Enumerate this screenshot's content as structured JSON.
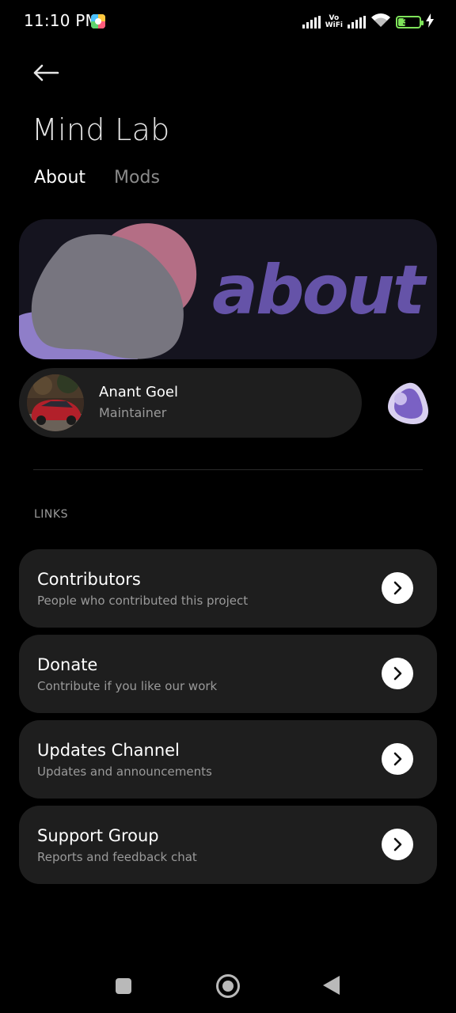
{
  "status_bar": {
    "time": "11:10 PM",
    "network_label_top": "Vo",
    "network_label_bottom": "WiFi",
    "battery_level": "33",
    "battery_color": "#7ee35a"
  },
  "header": {
    "back_icon": "arrow-left-icon",
    "title": "Mind Lab"
  },
  "tabs": [
    {
      "label": "About",
      "active": true
    },
    {
      "label": "Mods",
      "active": false
    }
  ],
  "banner": {
    "text": "about",
    "background": "#15141f",
    "accent": "#6553a8"
  },
  "maintainer": {
    "name": "Anant Goel",
    "role": "Maintainer"
  },
  "links_section": {
    "label": "LINKS",
    "items": [
      {
        "title": "Contributors",
        "subtitle": "People who contributed this project"
      },
      {
        "title": "Donate",
        "subtitle": "Contribute if you like our work"
      },
      {
        "title": "Updates Channel",
        "subtitle": "Updates and announcements"
      },
      {
        "title": "Support Group",
        "subtitle": "Reports and feedback chat"
      }
    ]
  },
  "nav_bar": {
    "recents_icon": "square-icon",
    "home_icon": "circle-icon",
    "back_icon": "triangle-back-icon"
  }
}
